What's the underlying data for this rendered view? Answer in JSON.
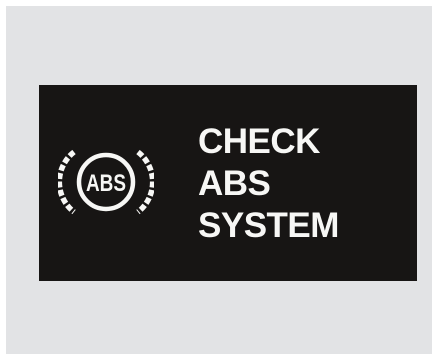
{
  "warning_display": {
    "icon": {
      "name": "abs-warning-icon",
      "label": "ABS"
    },
    "message_lines": [
      "CHECK",
      "ABS",
      "SYSTEM"
    ]
  },
  "colors": {
    "panel_background": "#e2e3e5",
    "display_background": "#171514",
    "foreground": "#f7f7f5"
  }
}
